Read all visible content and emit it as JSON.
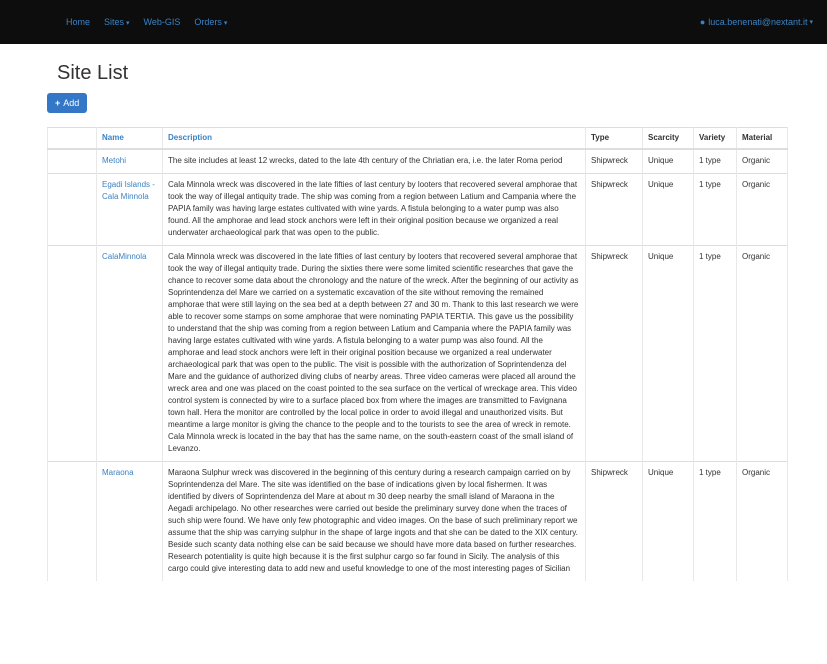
{
  "nav": {
    "items": [
      "Home",
      "Sites",
      "Web-GIS",
      "Orders"
    ],
    "user": "luca.benenati@nextant.it"
  },
  "page": {
    "title": "Site List",
    "add_label": "Add"
  },
  "table": {
    "headers": {
      "name": "Name",
      "description": "Description",
      "type": "Type",
      "scarcity": "Scarcity",
      "variety": "Variety",
      "material": "Material"
    },
    "rows": [
      {
        "name": "Metohi",
        "description": "The site includes at least 12 wrecks, dated to the late 4th century of the Chriatian era, i.e. the later Roma period",
        "type": "Shipwreck",
        "scarcity": "Unique",
        "variety": "1 type",
        "material": "Organic"
      },
      {
        "name": "Egadi Islands - Cala Minnola",
        "description": "Cala Minnola wreck was discovered in the late fifties of last century by looters that recovered several amphorae that took the way of illegal antiquity trade. The ship was coming from a region between Latium and Campania where the PAPIA family was having large estates cultivated with wine yards. A fistula belonging to a water pump was also found. All the amphorae and lead stock anchors were left in their original position because we organized a real underwater archaeological park that was open to the public.",
        "type": "Shipwreck",
        "scarcity": "Unique",
        "variety": "1 type",
        "material": "Organic"
      },
      {
        "name": "CalaMinnola",
        "description": "Cala Minnola wreck was discovered in the late fifties of last century by looters that recovered several amphorae that took the way of illegal antiquity trade. During the sixties there were some limited scientific researches that gave the chance to recover some data about the chronology and the nature of the wreck. After the beginning of our activity as Soprintendenza del Mare we carried on a systematic excavation of the site without removing the remained amphorae that were still laying on the sea bed at a depth between 27 and 30 m. Thank to this last research we were able to recover some stamps on some amphorae that were nominating PAPIA TERTIA. This gave us the possibility to understand that the ship was coming from a region between Latium and Campania where the PAPIA family was having large estates cultivated with wine yards. A fistula belonging to a water pump was also found. All the amphorae and lead stock anchors were left in their original position because we organized a real underwater archaeological park that was open to the public. The visit is possible with the authorization of Soprintendenza del Mare and the guidance of authorized diving clubs of nearby areas. Three video cameras were placed all around the wreck area and one was placed on the coast pointed to the sea surface on the vertical of wreckage area. This video control system is connected by wire to a surface placed box from where the images are transmitted to Favignana town hall. Hera the monitor are controlled by the local police in order to avoid illegal and unauthorized visits. But meantime a large monitor is giving the chance to the people and to the tourists to see the area of wreck in remote. Cala Minnola wreck is located in the bay that has the same name, on the south-eastern coast of the small island of Levanzo.",
        "type": "Shipwreck",
        "scarcity": "Unique",
        "variety": "1 type",
        "material": "Organic"
      },
      {
        "name": "Maraona",
        "description": "Maraona Sulphur wreck was discovered in the beginning of this century during a research campaign carried on by Soprintendenza del Mare. The site was identified on the base of indications given by local fishermen. It was identified by divers of Soprintendenza del Mare at about m 30 deep nearby the small island of Maraona in the Aegadi archipelago. No other researches were carried out beside the preliminary survey done when the traces of such ship were found. We have only few photographic and video images. On the base of such preliminary report we assume that the ship was carrying sulphur in the shape of large ingots and that she can be dated to the XIX century. Beside such scanty data nothing else can be said because we should have more data based on further researches. Research potentiality is quite high because it is the first sulphur cargo so far found in Sicily. The analysis of this cargo could give interesting data to add new and useful knowledge to one of the most interesting pages of Sicilian",
        "type": "Shipwreck",
        "scarcity": "Unique",
        "variety": "1 type",
        "material": "Organic"
      }
    ]
  }
}
